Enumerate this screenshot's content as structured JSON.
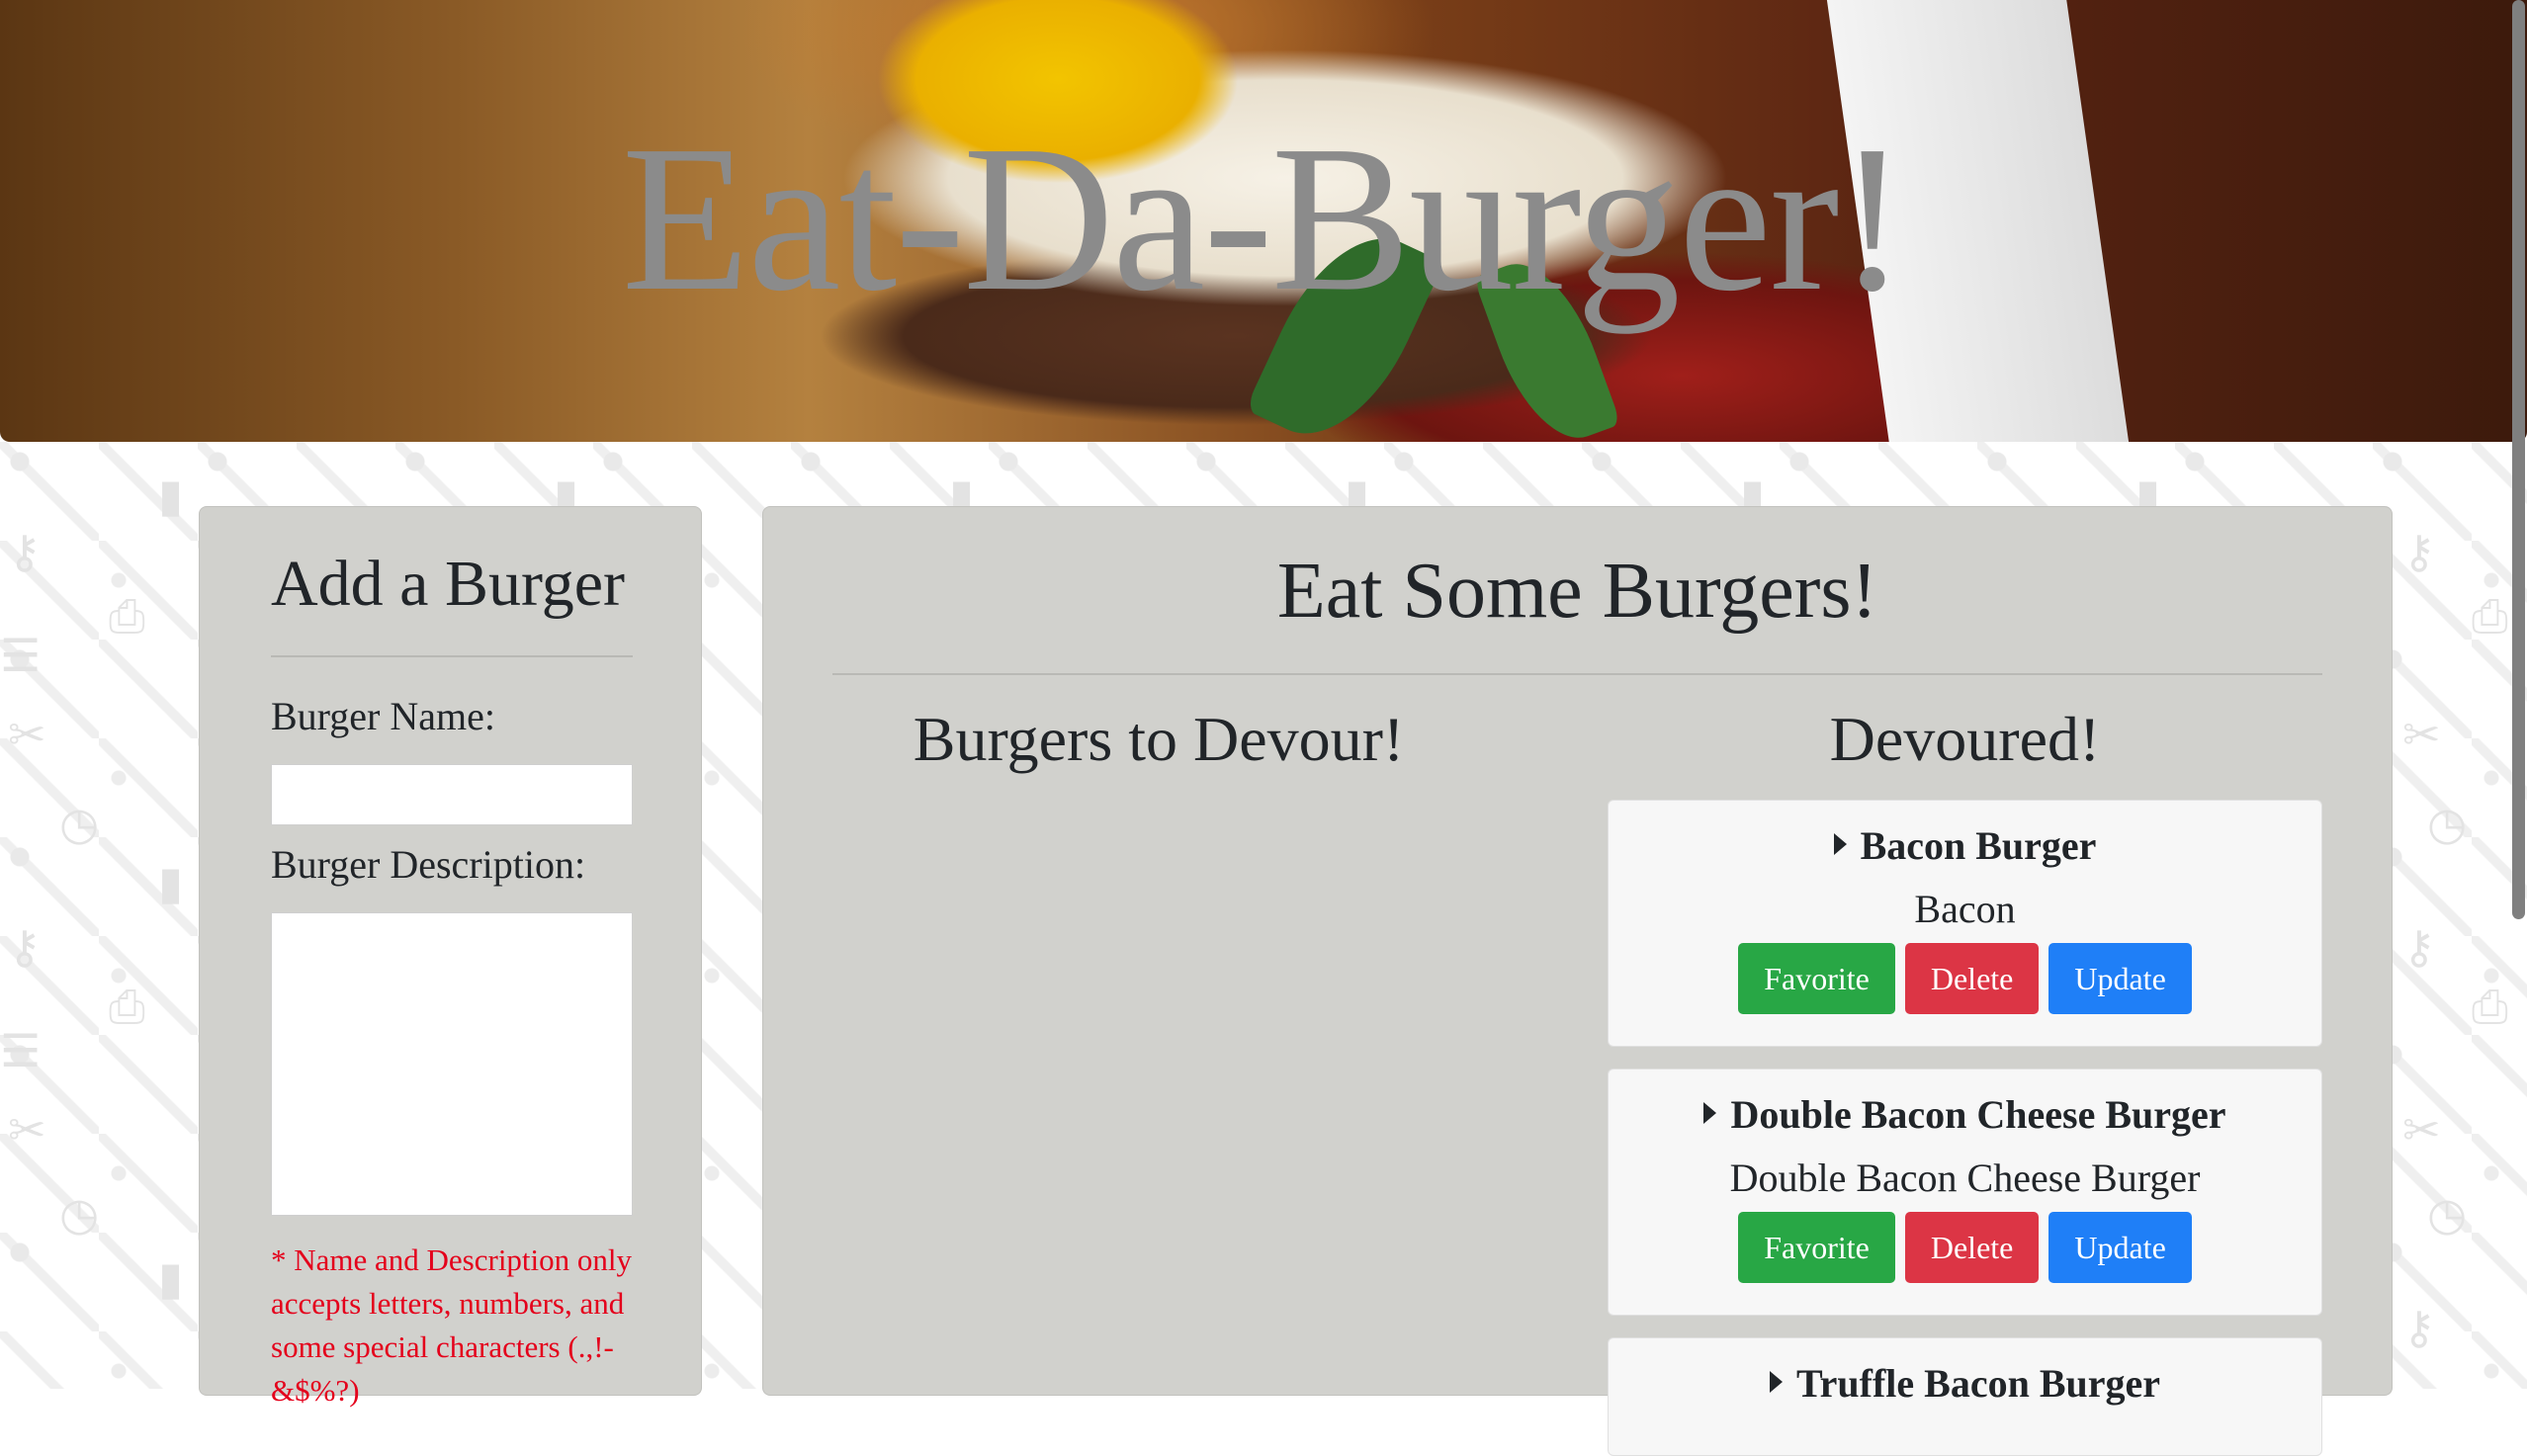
{
  "hero": {
    "title": "Eat-Da-Burger!"
  },
  "add_panel": {
    "title": "Add a Burger",
    "name_label": "Burger Name:",
    "name_value": "",
    "description_label": "Burger Description:",
    "description_value": "",
    "note": "* Name and Description only accepts letters, numbers, and some special characters (.,!-&$%?)"
  },
  "eat_panel": {
    "title": "Eat Some Burgers!",
    "to_devour_title": "Burgers to Devour!",
    "devoured_title": "Devoured!",
    "devoured": [
      {
        "name": "Bacon Burger",
        "description": "Bacon"
      },
      {
        "name": "Double Bacon Cheese Burger",
        "description": "Double Bacon Cheese Burger"
      },
      {
        "name": "Truffle Bacon Burger",
        "description": ""
      }
    ],
    "buttons": {
      "favorite": "Favorite",
      "delete": "Delete",
      "update": "Update"
    }
  },
  "colors": {
    "panel": "#d1d1cd",
    "favorite": "#28a745",
    "delete": "#dc3545",
    "update": "#1f7ff7",
    "note": "#e4001b"
  }
}
